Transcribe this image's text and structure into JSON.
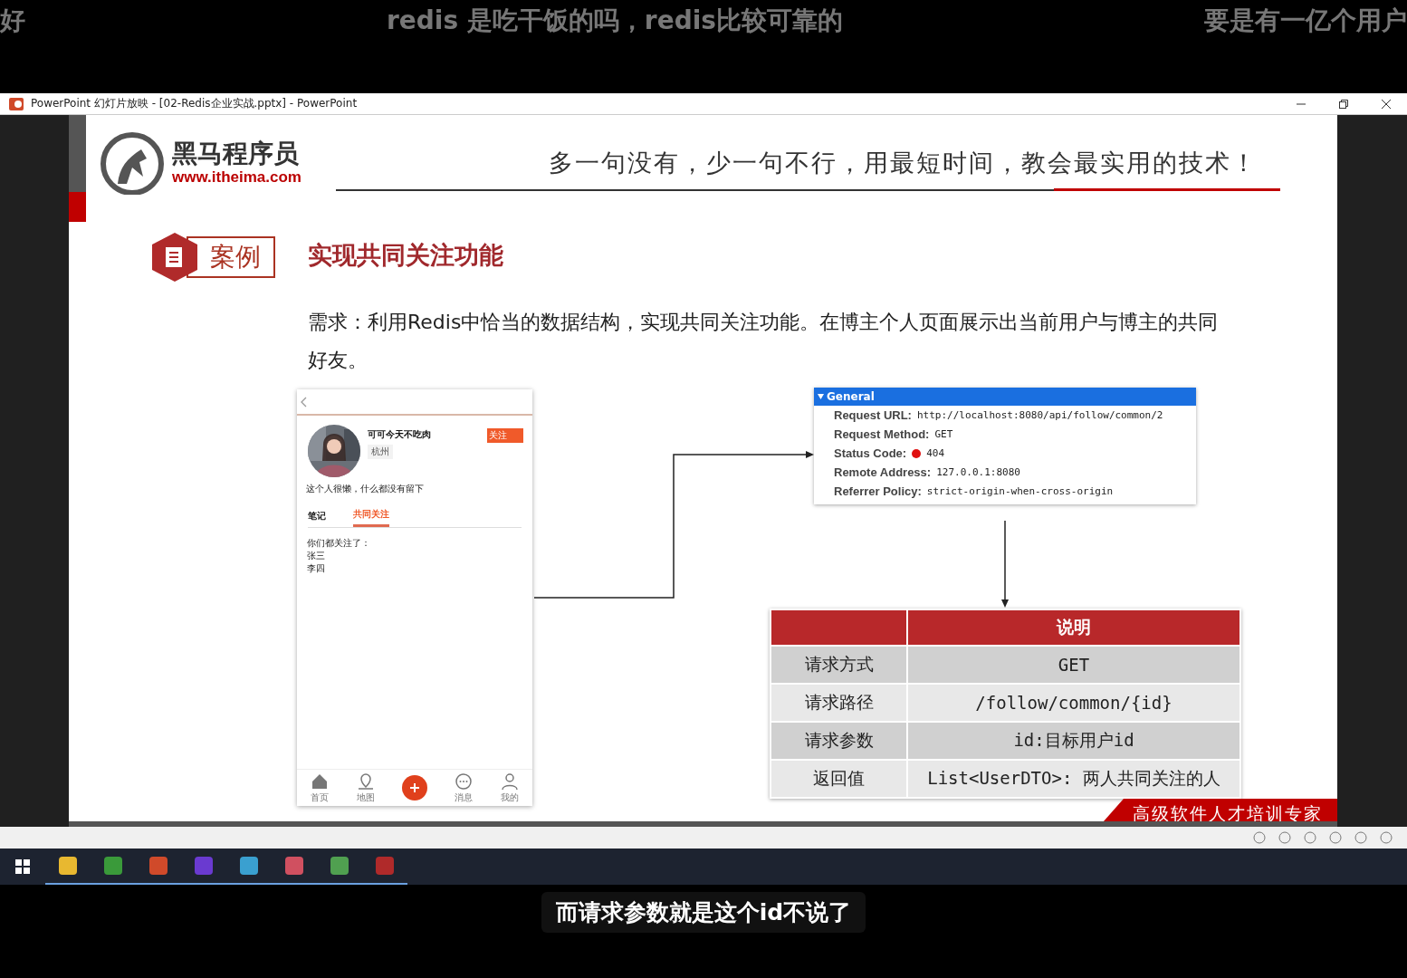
{
  "danmaku": [
    "好",
    "redis 是吃干饭的吗，redis比较可靠的",
    "要是有一亿个用户"
  ],
  "window": {
    "title": "PowerPoint 幻灯片放映 - [02-Redis企业实战.pptx] - PowerPoint"
  },
  "slide": {
    "logo_name": "黑马程序员",
    "logo_url": "www.itheima.com",
    "slogan": "多一句没有，少一句不行，用最短时间，教会最实用的技术！",
    "case_label": "案例",
    "title": "实现共同关注功能",
    "requirement": "需求：利用Redis中恰当的数据结构，实现共同关注功能。在博主个人页面展示出当前用户与博主的共同好友。",
    "phone": {
      "name": "可可今天不吃肉",
      "city": "杭州",
      "follow_button": "关注",
      "bio": "这个人很懒，什么都没有留下",
      "tabs": [
        {
          "label": "笔记",
          "selected": false
        },
        {
          "label": "共同关注",
          "selected": true
        }
      ],
      "content": [
        "你们都关注了：",
        "张三",
        "李四"
      ],
      "nav": [
        {
          "label": "首页",
          "kind": "home"
        },
        {
          "label": "地图",
          "kind": "map"
        },
        {
          "kind": "add"
        },
        {
          "label": "消息",
          "kind": "message"
        },
        {
          "label": "我的",
          "kind": "user"
        }
      ]
    },
    "general": {
      "header": "General",
      "rows": [
        {
          "label": "Request URL:",
          "value": "http://localhost:8080/api/follow/common/2"
        },
        {
          "label": "Request Method:",
          "value": "GET"
        },
        {
          "label": "Status Code:",
          "value": "404",
          "color": "#e01010"
        },
        {
          "label": "Remote Address:",
          "value": "127.0.0.1:8080"
        },
        {
          "label": "Referrer Policy:",
          "value": "strict-origin-when-cross-origin"
        }
      ]
    },
    "table": {
      "header": "说明",
      "rows": [
        [
          "请求方式",
          "GET"
        ],
        [
          "请求路径",
          "/follow/common/{id}"
        ],
        [
          "请求参数",
          "id:目标用户id"
        ],
        [
          "返回值",
          "List<UserDTO>: 两人共同关注的人"
        ]
      ]
    },
    "footer": "高级软件人才培训专家"
  },
  "caption": "而请求参数就是这个id不说了"
}
